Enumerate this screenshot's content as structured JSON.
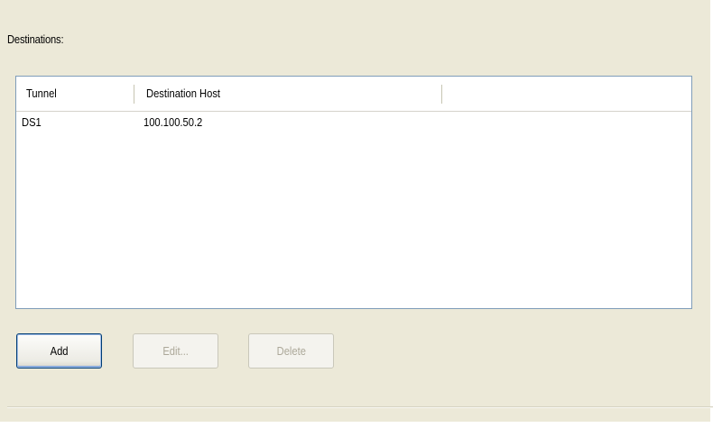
{
  "destinations": {
    "label": "Destinations:",
    "columns": [
      "Tunnel",
      "Destination Host",
      ""
    ],
    "rows": [
      {
        "tunnel": "DS1",
        "destination_host": "100.100.50.2"
      }
    ]
  },
  "buttons": {
    "add": "Add",
    "edit": "Edit...",
    "delete": "Delete"
  },
  "colors": {
    "panel_background": "#ece9d8",
    "list_border": "#7f9db9",
    "button_border": "#003c74",
    "disabled_text": "#aca899"
  }
}
